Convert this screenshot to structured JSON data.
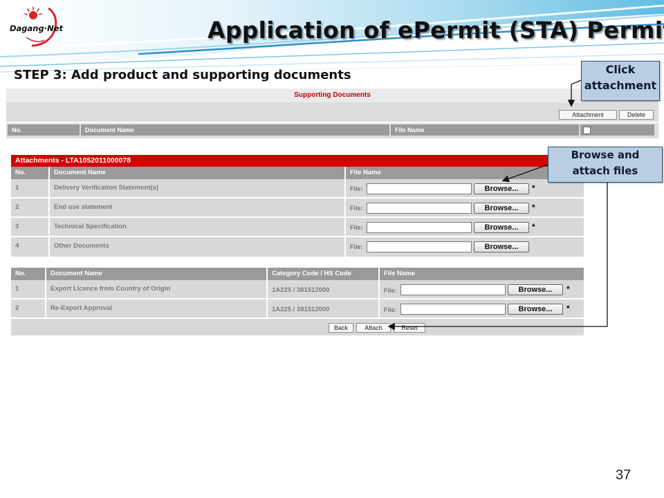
{
  "header": {
    "logo_text": "Dagang·Net",
    "title": "Application of ePermit (STA) Permit",
    "step": "STEP 3: Add product and supporting documents"
  },
  "callouts": {
    "click_attachment": [
      "Click",
      "attachment"
    ],
    "browse_attach": [
      "Browse and",
      "attach files"
    ]
  },
  "supporting_documents": {
    "title": "Supporting Documents",
    "attachment_button": "Attachment",
    "delete_button": "Delete",
    "columns": [
      "No.",
      "Document Name",
      "File Name"
    ]
  },
  "attachments": {
    "title": "Attachments - LTA1052011000078",
    "columns": [
      "No.",
      "Document Name",
      "File Name"
    ],
    "rows": [
      {
        "no": "1",
        "name": "Delivery Verification Statement(s)",
        "required": true
      },
      {
        "no": "2",
        "name": "End use statement",
        "required": true
      },
      {
        "no": "3",
        "name": "Technical Specification",
        "required": true
      },
      {
        "no": "4",
        "name": "Other Documents",
        "required": false
      }
    ],
    "file_label": "File:",
    "browse_label": "Browse...",
    "required_mark": "*"
  },
  "product_attachments": {
    "columns": [
      "No.",
      "Document Name",
      "Category Code / HS Code",
      "File Name"
    ],
    "rows": [
      {
        "no": "1",
        "name": "Export Licence from Country of Origin",
        "code": "1A225 / 381512000"
      },
      {
        "no": "2",
        "name": "Re-Export Approval",
        "code": "1A225 / 381512000"
      }
    ],
    "back_button": "Back",
    "attach_button": "Attach",
    "reset_button": "Reset"
  },
  "page_number": "37",
  "colors": {
    "accent_red": "#d40000",
    "callout_bg": "#b9cde3",
    "header_gray": "#9a9a9a",
    "row_gray": "#d8d8d8"
  }
}
